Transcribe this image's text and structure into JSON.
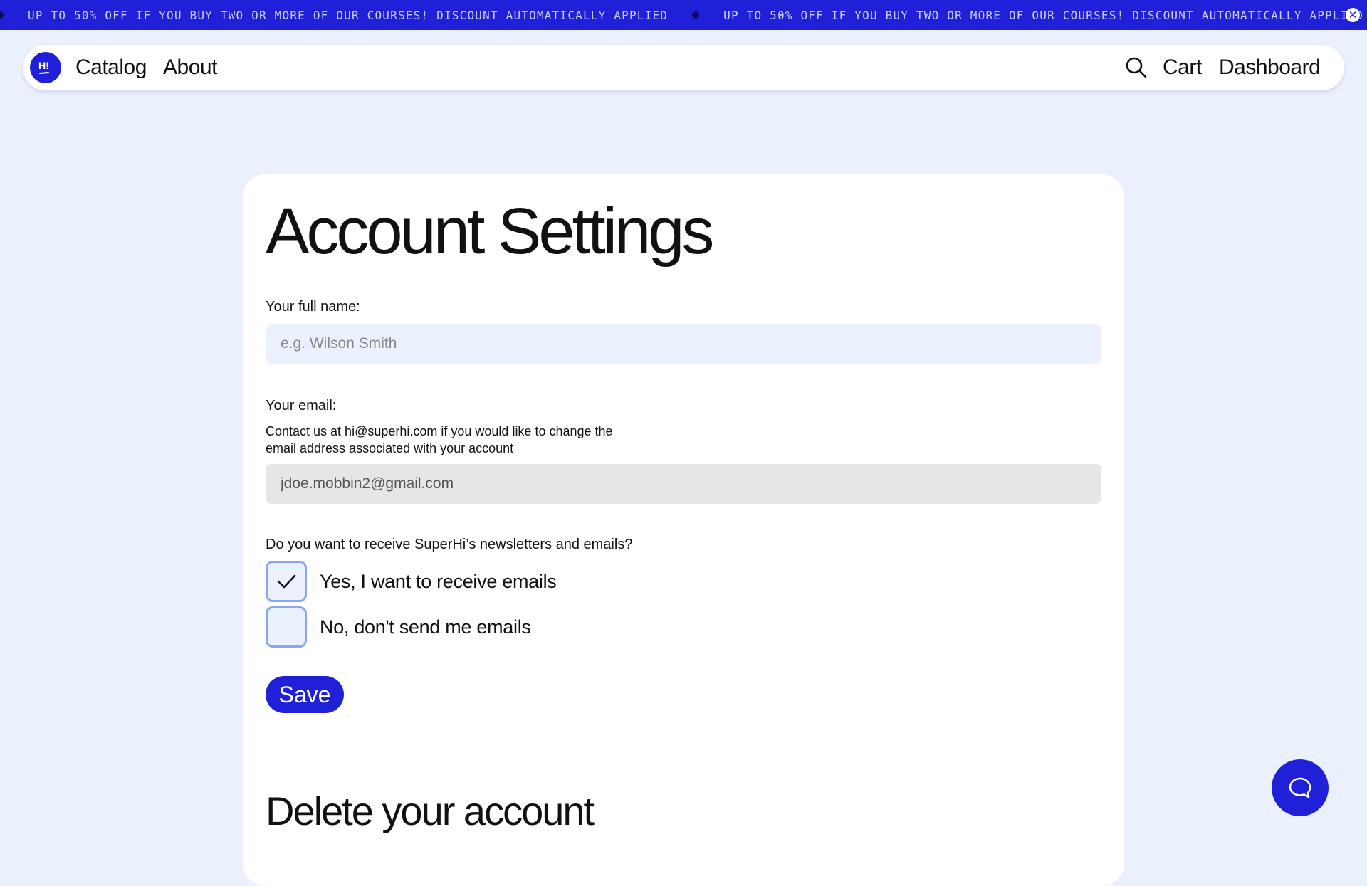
{
  "banner": {
    "text": "UP TO 50% OFF IF YOU BUY TWO OR MORE OF OUR COURSES! DISCOUNT AUTOMATICALLY APPLIED",
    "text_repeat": "UP TO 50% OFF IF YOU BUY TWO OR MORE OF OUR COURSES! DISCOUNT AUTOMATICALLY APPLIED",
    "close_icon": "close-icon",
    "color": "#2020d8"
  },
  "nav": {
    "logo_text": "H!",
    "links": [
      {
        "label": "Catalog"
      },
      {
        "label": "About"
      }
    ],
    "search_icon": "search-icon",
    "cart_label": "Cart",
    "dashboard_label": "Dashboard"
  },
  "settings": {
    "title": "Account Settings",
    "name_label": "Your full name:",
    "name_placeholder": "e.g. Wilson Smith",
    "name_value": "",
    "email_label": "Your email:",
    "email_hint": "Contact us at hi@superhi.com if you would like to change the email address associated with your account",
    "email_value": "jdoe.mobbin2@gmail.com",
    "newsletter_question": "Do you want to receive SuperHi’s newsletters and emails?",
    "options": [
      {
        "label": "Yes, I want to receive emails",
        "checked": true
      },
      {
        "label": "No, don't send me emails",
        "checked": false
      }
    ],
    "save_label": "Save"
  },
  "delete": {
    "title": "Delete your account",
    "text": ""
  },
  "chat": {
    "icon": "chat-bubble-icon"
  },
  "colors": {
    "accent": "#2020d8",
    "page_bg": "#ebf0fd",
    "checkbox_border": "#8aa8f2"
  }
}
